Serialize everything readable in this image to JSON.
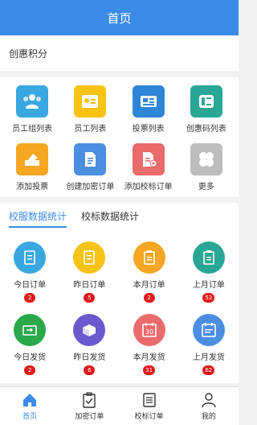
{
  "header": {
    "title": "首页"
  },
  "points": {
    "label": "创惠积分"
  },
  "grid_items": [
    {
      "label": "员工组列表",
      "icon": "group-icon",
      "color": "#3aa7e0"
    },
    {
      "label": "员工列表",
      "icon": "id-card-icon",
      "color": "#f7c315"
    },
    {
      "label": "投票列表",
      "icon": "newspaper-icon",
      "color": "#2f86d6"
    },
    {
      "label": "创惠码列表",
      "icon": "card-icon",
      "color": "#2aa695"
    },
    {
      "label": "添加投票",
      "icon": "ticket-icon",
      "color": "#f5a623"
    },
    {
      "label": "创建加密订单",
      "icon": "document-icon",
      "color": "#4c8fe0"
    },
    {
      "label": "添加校标订单",
      "icon": "document-add-icon",
      "color": "#ea6b6b"
    },
    {
      "label": "更多",
      "icon": "clover-icon",
      "color": "#bdbdbd"
    }
  ],
  "stats": {
    "tabs": [
      {
        "label": "校服数据统计",
        "active": true
      },
      {
        "label": "校标数据统计",
        "active": false
      }
    ],
    "items": [
      {
        "label": "今日订单",
        "count": "2",
        "color": "#3aa7e0",
        "icon": "order-icon"
      },
      {
        "label": "昨日订单",
        "count": "5",
        "color": "#f7c315",
        "icon": "order-icon"
      },
      {
        "label": "本月订单",
        "count": "2",
        "color": "#f5a623",
        "icon": "clipboard-icon"
      },
      {
        "label": "上月订单",
        "count": "52",
        "color": "#2aa695",
        "icon": "clipboard-icon"
      },
      {
        "label": "今日发货",
        "count": "2",
        "color": "#2aa84a",
        "icon": "truck-icon"
      },
      {
        "label": "昨日发货",
        "count": "6",
        "color": "#6a5acd",
        "icon": "box-icon"
      },
      {
        "label": "本月发货",
        "count": "31",
        "color": "#ea6b6b",
        "icon": "calendar-30-icon"
      },
      {
        "label": "上月发货",
        "count": "62",
        "color": "#4c8fe0",
        "icon": "calendar-icon"
      }
    ]
  },
  "tabbar": [
    {
      "label": "首页",
      "icon": "home-icon",
      "active": true
    },
    {
      "label": "加密订单",
      "icon": "clipboard-check-icon",
      "active": false
    },
    {
      "label": "校标订单",
      "icon": "list-icon",
      "active": false
    },
    {
      "label": "我的",
      "icon": "user-icon",
      "active": false
    }
  ],
  "colors": {
    "primary": "#3c8ce7",
    "badge": "#e21a1a"
  }
}
